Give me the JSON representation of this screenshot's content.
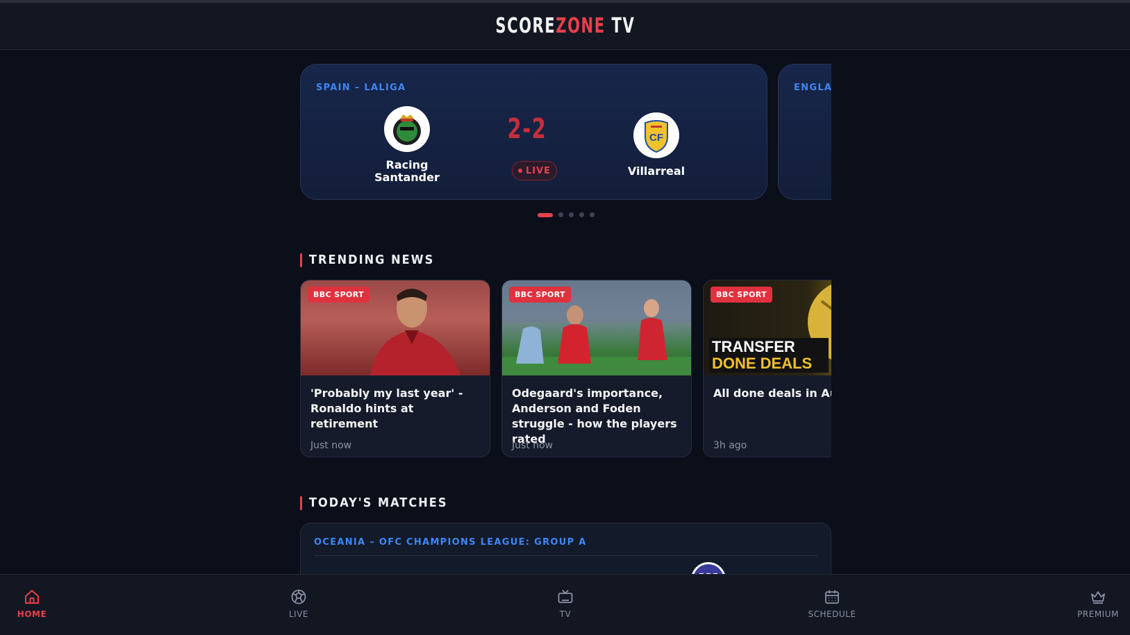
{
  "header": {
    "brand_part1": "SCORE",
    "brand_part2": "ZONE",
    "brand_part3": " TV"
  },
  "featured_matches": [
    {
      "league": "SPAIN – LALIGA",
      "home_team": "Racing Santander",
      "away_team": "Villarreal",
      "score": "2-2",
      "status": "LIVE"
    },
    {
      "league": "ENGLAN"
    }
  ],
  "carousel": {
    "count": 5,
    "active_index": 0
  },
  "trending": {
    "title": "TRENDING NEWS",
    "articles": [
      {
        "source": "BBC SPORT",
        "title": "'Probably my last year' - Ronaldo hints at retirement",
        "time": "Just now"
      },
      {
        "source": "BBC SPORT",
        "title": "Odegaard's importance, Anderson and Foden struggle - how the players rated",
        "time": "Just now"
      },
      {
        "source": "BBC SPORT",
        "title": "All done deals in Augu",
        "time": "3h ago",
        "image_text_line1": "TRANSFER",
        "image_text_line2": "DONE DEALS"
      }
    ]
  },
  "today": {
    "title": "TODAY'S MATCHES",
    "league": "OCEANIA – OFC CHAMPIONS LEAGUE: GROUP A"
  },
  "nav": {
    "items": [
      {
        "label": "HOME",
        "icon": "home-icon",
        "active": true
      },
      {
        "label": "LIVE",
        "icon": "ball-icon",
        "active": false
      },
      {
        "label": "TV",
        "icon": "tv-icon",
        "active": false
      },
      {
        "label": "SCHEDULE",
        "icon": "calendar-icon",
        "active": false
      },
      {
        "label": "PREMIUM",
        "icon": "crown-icon",
        "active": false
      }
    ]
  },
  "colors": {
    "accent": "#e8404a",
    "league_blue": "#3f86f4",
    "background": "#0b0f1a"
  }
}
